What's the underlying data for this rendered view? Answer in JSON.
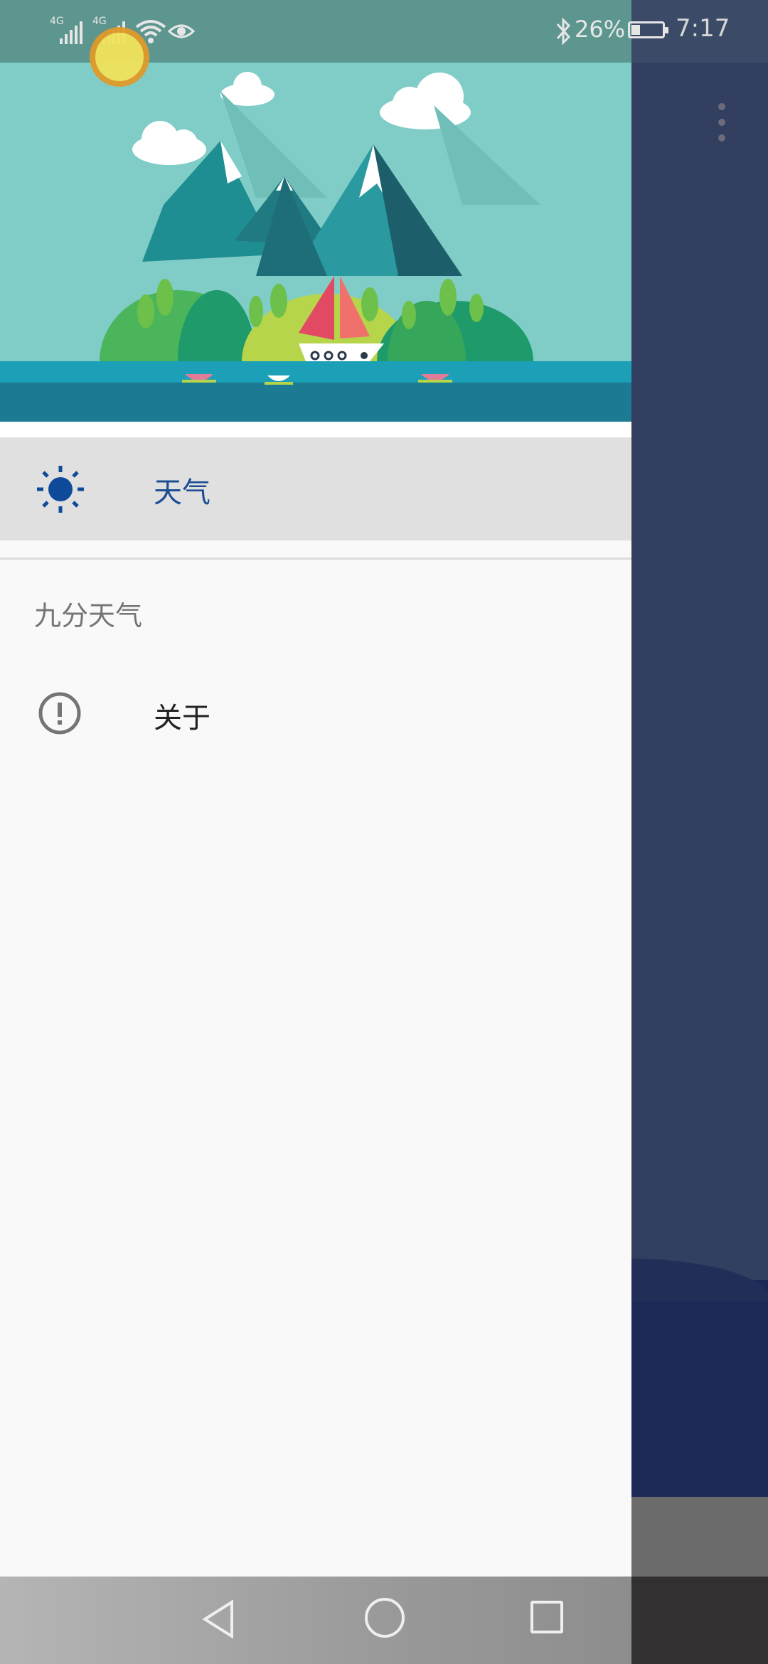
{
  "status_bar": {
    "signal_1_label": "4G",
    "signal_2_label": "4G",
    "battery_percent": "26%",
    "time": "7:17"
  },
  "drawer": {
    "items": [
      {
        "label": "天气",
        "icon": "sun-icon",
        "selected": true
      },
      {
        "label": "关于",
        "icon": "info-icon",
        "selected": false
      }
    ],
    "section_title": "九分天气"
  },
  "colors": {
    "status_bar": "#5c968f",
    "selected_row": "#e0e0e0",
    "selected_text": "#1d4e93",
    "app_background": "#323f60"
  }
}
